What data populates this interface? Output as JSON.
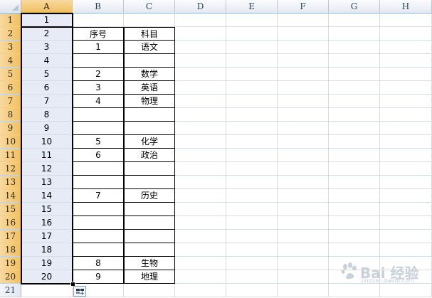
{
  "sheet": {
    "columns": [
      "A",
      "B",
      "C",
      "D",
      "E",
      "F",
      "G",
      "H"
    ],
    "rows": [
      "1",
      "2",
      "3",
      "4",
      "5",
      "6",
      "7",
      "8",
      "9",
      "10",
      "11",
      "12",
      "13",
      "14",
      "15",
      "16",
      "17",
      "18",
      "19",
      "20",
      "21"
    ],
    "selected_column": "A",
    "selected_rows": [
      "1",
      "2",
      "3",
      "4",
      "5",
      "6",
      "7",
      "8",
      "9",
      "10",
      "11",
      "12",
      "13",
      "14",
      "15",
      "16",
      "17",
      "18",
      "19",
      "20"
    ]
  },
  "cells": {
    "A": [
      "1",
      "2",
      "3",
      "4",
      "5",
      "6",
      "7",
      "8",
      "9",
      "10",
      "11",
      "12",
      "13",
      "14",
      "15",
      "16",
      "17",
      "18",
      "19",
      "20",
      ""
    ],
    "B": [
      "",
      "序号",
      "1",
      "",
      "2",
      "3",
      "4",
      "",
      "",
      "5",
      "6",
      "",
      "",
      "7",
      "",
      "",
      "",
      "",
      "8",
      "9",
      ""
    ],
    "C": [
      "",
      "科目",
      "语文",
      "",
      "数学",
      "英语",
      "物理",
      "",
      "",
      "化学",
      "政治",
      "",
      "",
      "历史",
      "",
      "",
      "",
      "",
      "生物",
      "地理",
      ""
    ]
  },
  "colors": {
    "header_selected": "#f1c15f",
    "column_a_fill": "#e7ebf5",
    "grid_line": "#d4dde8"
  },
  "watermark": {
    "text": "Bai 经验",
    "sub": "jingyan.baidu.com"
  },
  "icons": {
    "autofill": "autofill-options-icon",
    "select_all": "select-all-triangle-icon"
  }
}
